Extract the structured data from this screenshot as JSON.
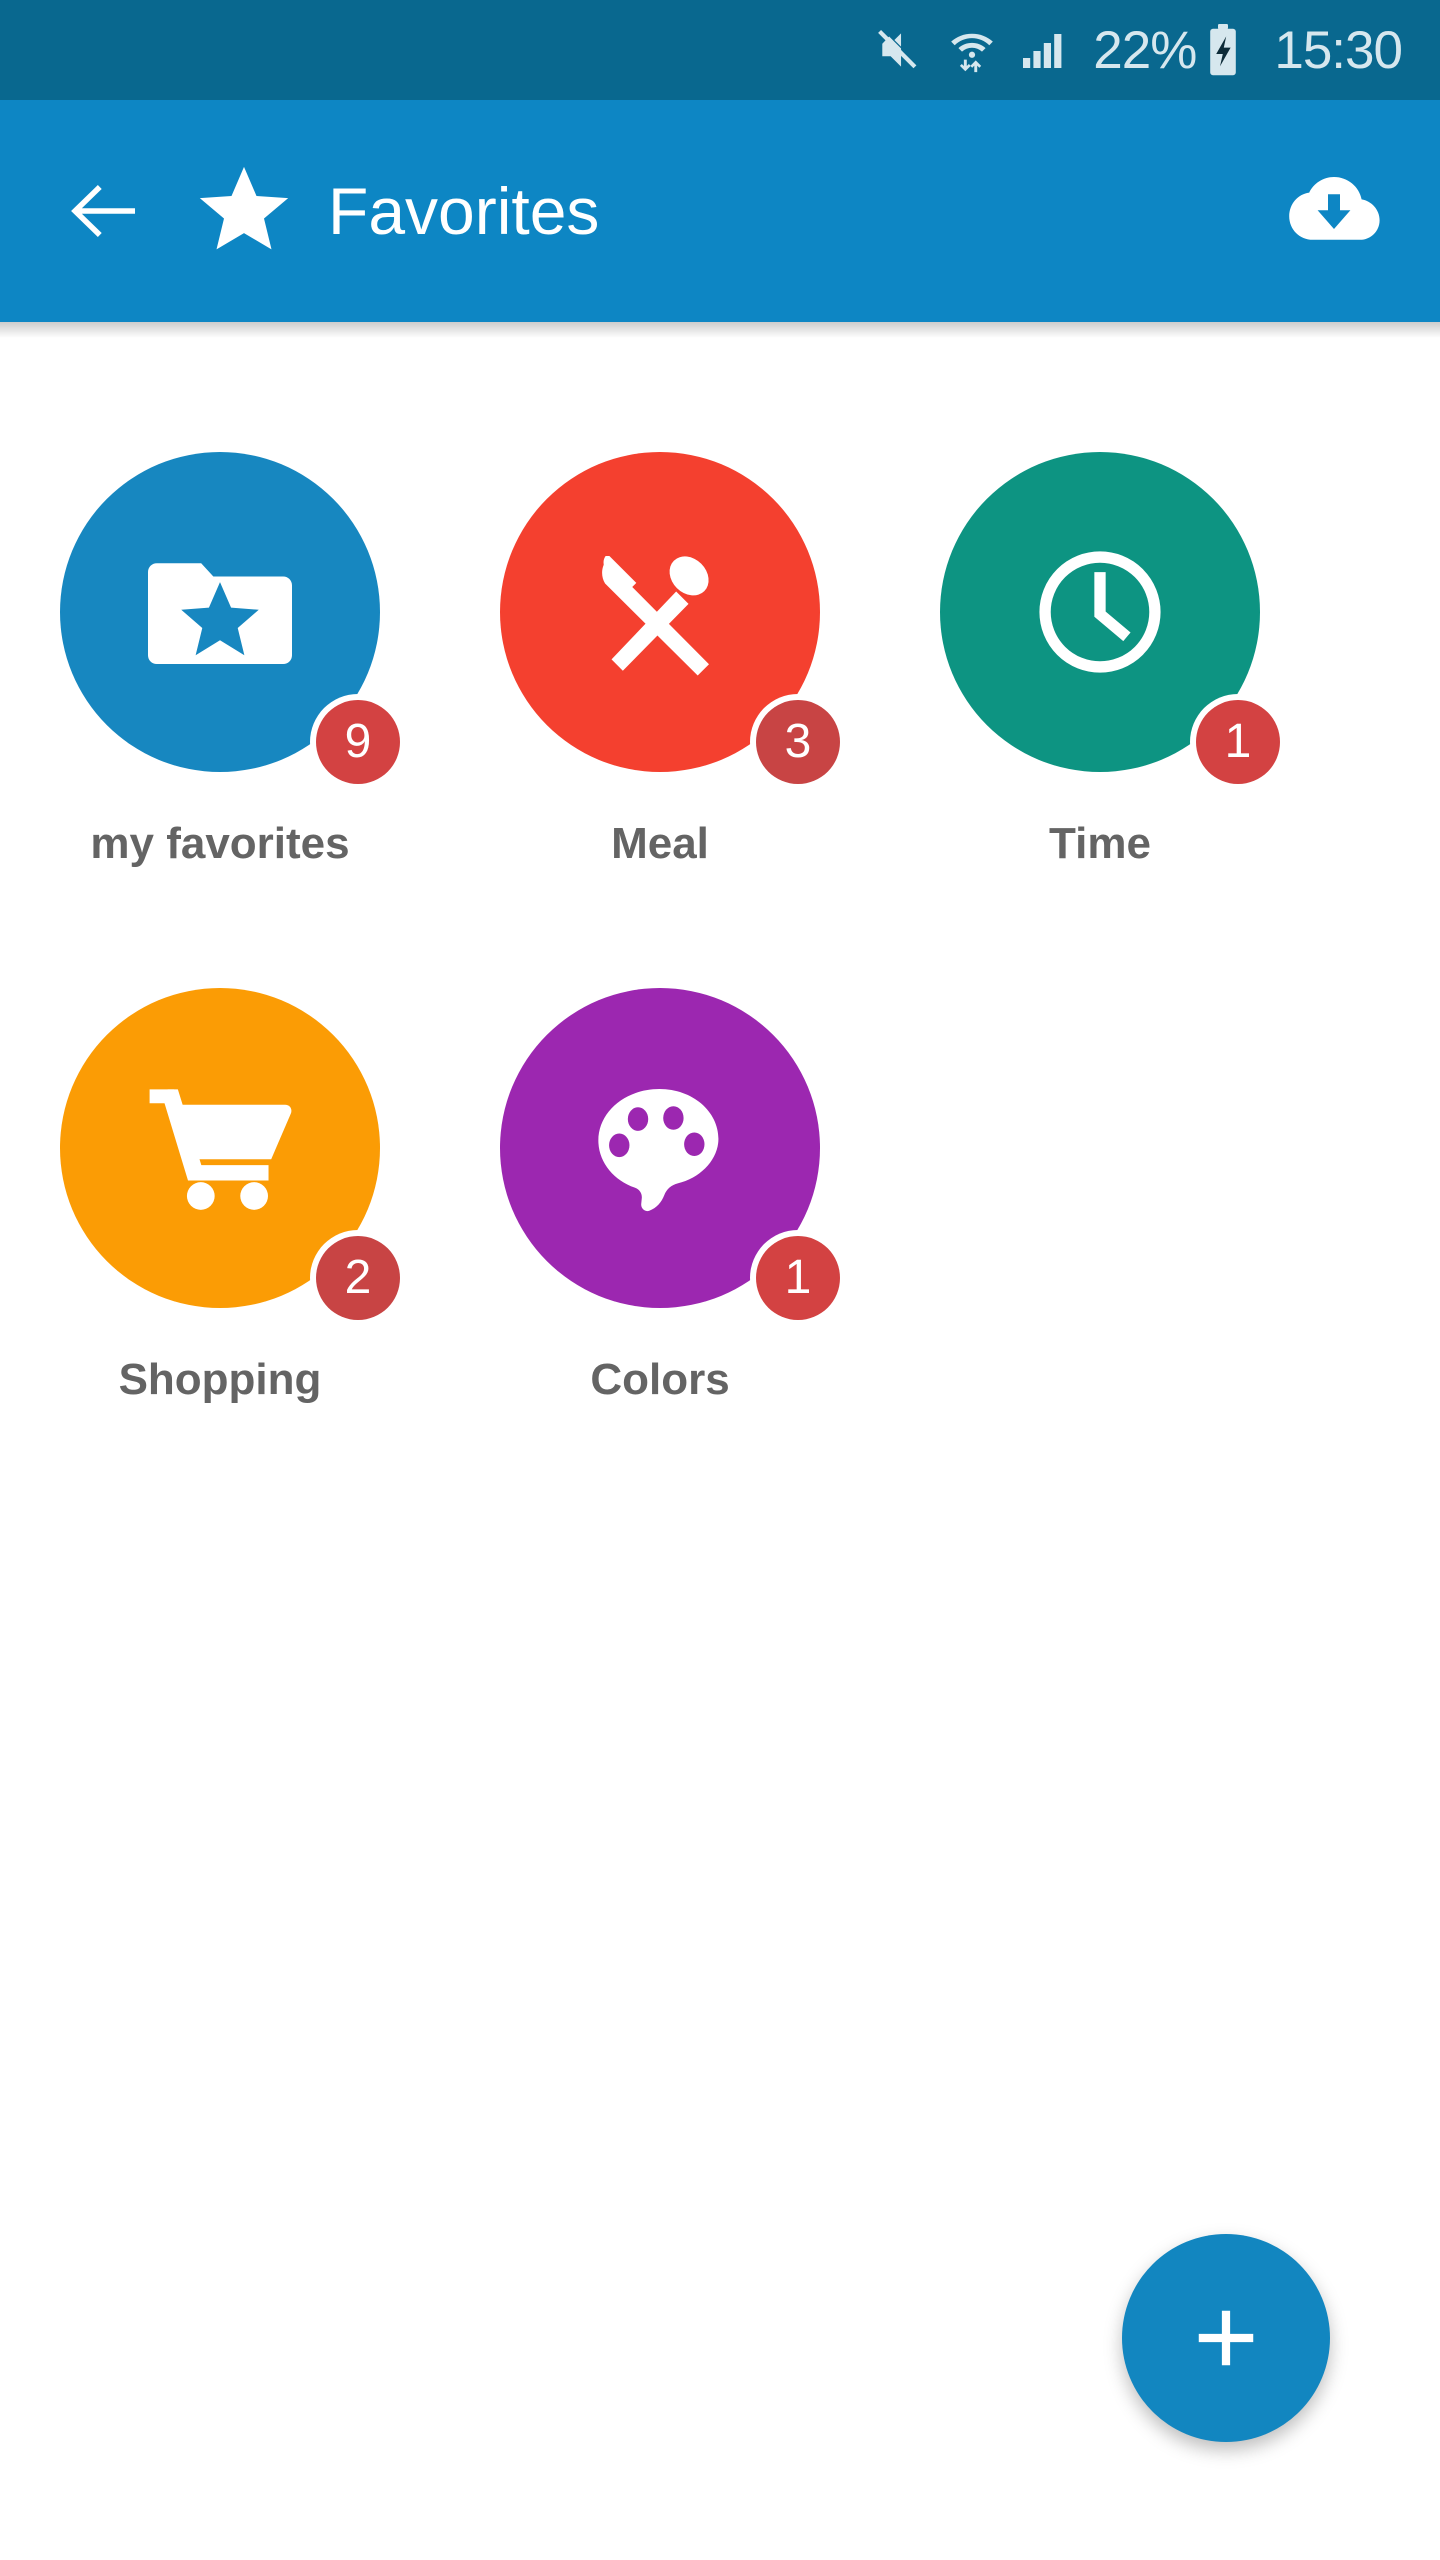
{
  "status_bar": {
    "background": "#09688f",
    "text_color": "#d6e7ee",
    "battery_percent": "22%",
    "clock": "15:30",
    "icons": [
      "mute-icon",
      "wifi-icon",
      "signal-icon",
      "battery-charging-icon"
    ]
  },
  "app_bar": {
    "background": "#0d86c4",
    "title": "Favorites",
    "back_icon": "arrow-left-icon",
    "brand_icon": "star-icon",
    "action_icon": "cloud-download-icon"
  },
  "grid": {
    "items": [
      {
        "label": "my favorites",
        "badge": "9",
        "color": "#1787c0",
        "badge_color": "#d34242",
        "icon": "folder-star-icon"
      },
      {
        "label": "Meal",
        "badge": "3",
        "color": "#f4402f",
        "badge_color": "#c84444",
        "icon": "knife-spoon-icon"
      },
      {
        "label": "Time",
        "badge": "1",
        "color": "#0d9482",
        "badge_color": "#d34242",
        "icon": "clock-icon"
      },
      {
        "label": "Shopping",
        "badge": "2",
        "color": "#fb9c05",
        "badge_color": "#c84444",
        "icon": "shopping-cart-icon"
      },
      {
        "label": "Colors",
        "badge": "1",
        "color": "#9c27b0",
        "badge_color": "#d34242",
        "icon": "palette-icon"
      }
    ]
  },
  "fab": {
    "icon": "plus-icon",
    "color": "#1286c0",
    "label": "+"
  }
}
